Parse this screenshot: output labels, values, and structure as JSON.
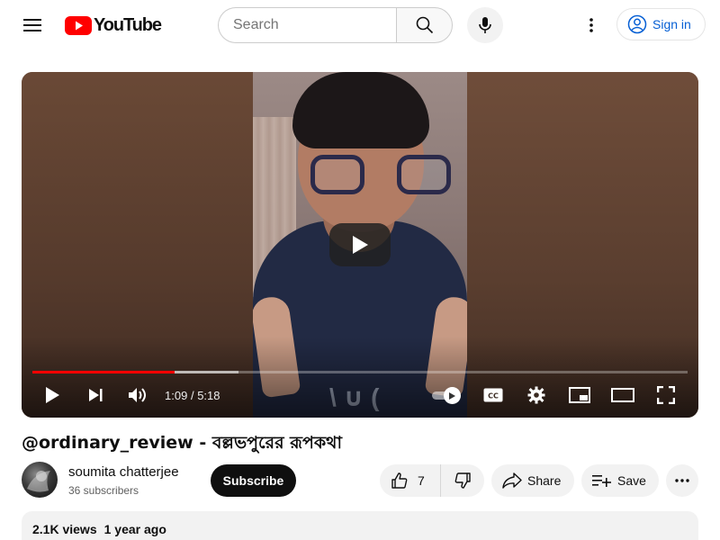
{
  "header": {
    "menu_icon": "hamburger-menu-icon",
    "logo_text": "YouTube",
    "search": {
      "placeholder": "Search",
      "value": ""
    },
    "signin_label": "Sign in"
  },
  "player": {
    "current_time": "1:09",
    "separator": "/",
    "duration": "5:18",
    "progress_fraction": 0.217,
    "buffered_fraction": 0.315,
    "shirt_print": "\\ ∪ ("
  },
  "video": {
    "title": "@ordinary_review - বল্লভপুরের রূপকথা"
  },
  "channel": {
    "name": "soumita chatterjee",
    "subscribers": "36 subscribers",
    "subscribe_label": "Subscribe"
  },
  "actions": {
    "like_count": "7",
    "share_label": "Share",
    "save_label": "Save"
  },
  "description": {
    "views": "2.1K views",
    "age": "1 year ago"
  },
  "colors": {
    "brand_red": "#FF0000",
    "link_blue": "#065FD4",
    "pill_bg": "#F2F2F2"
  }
}
